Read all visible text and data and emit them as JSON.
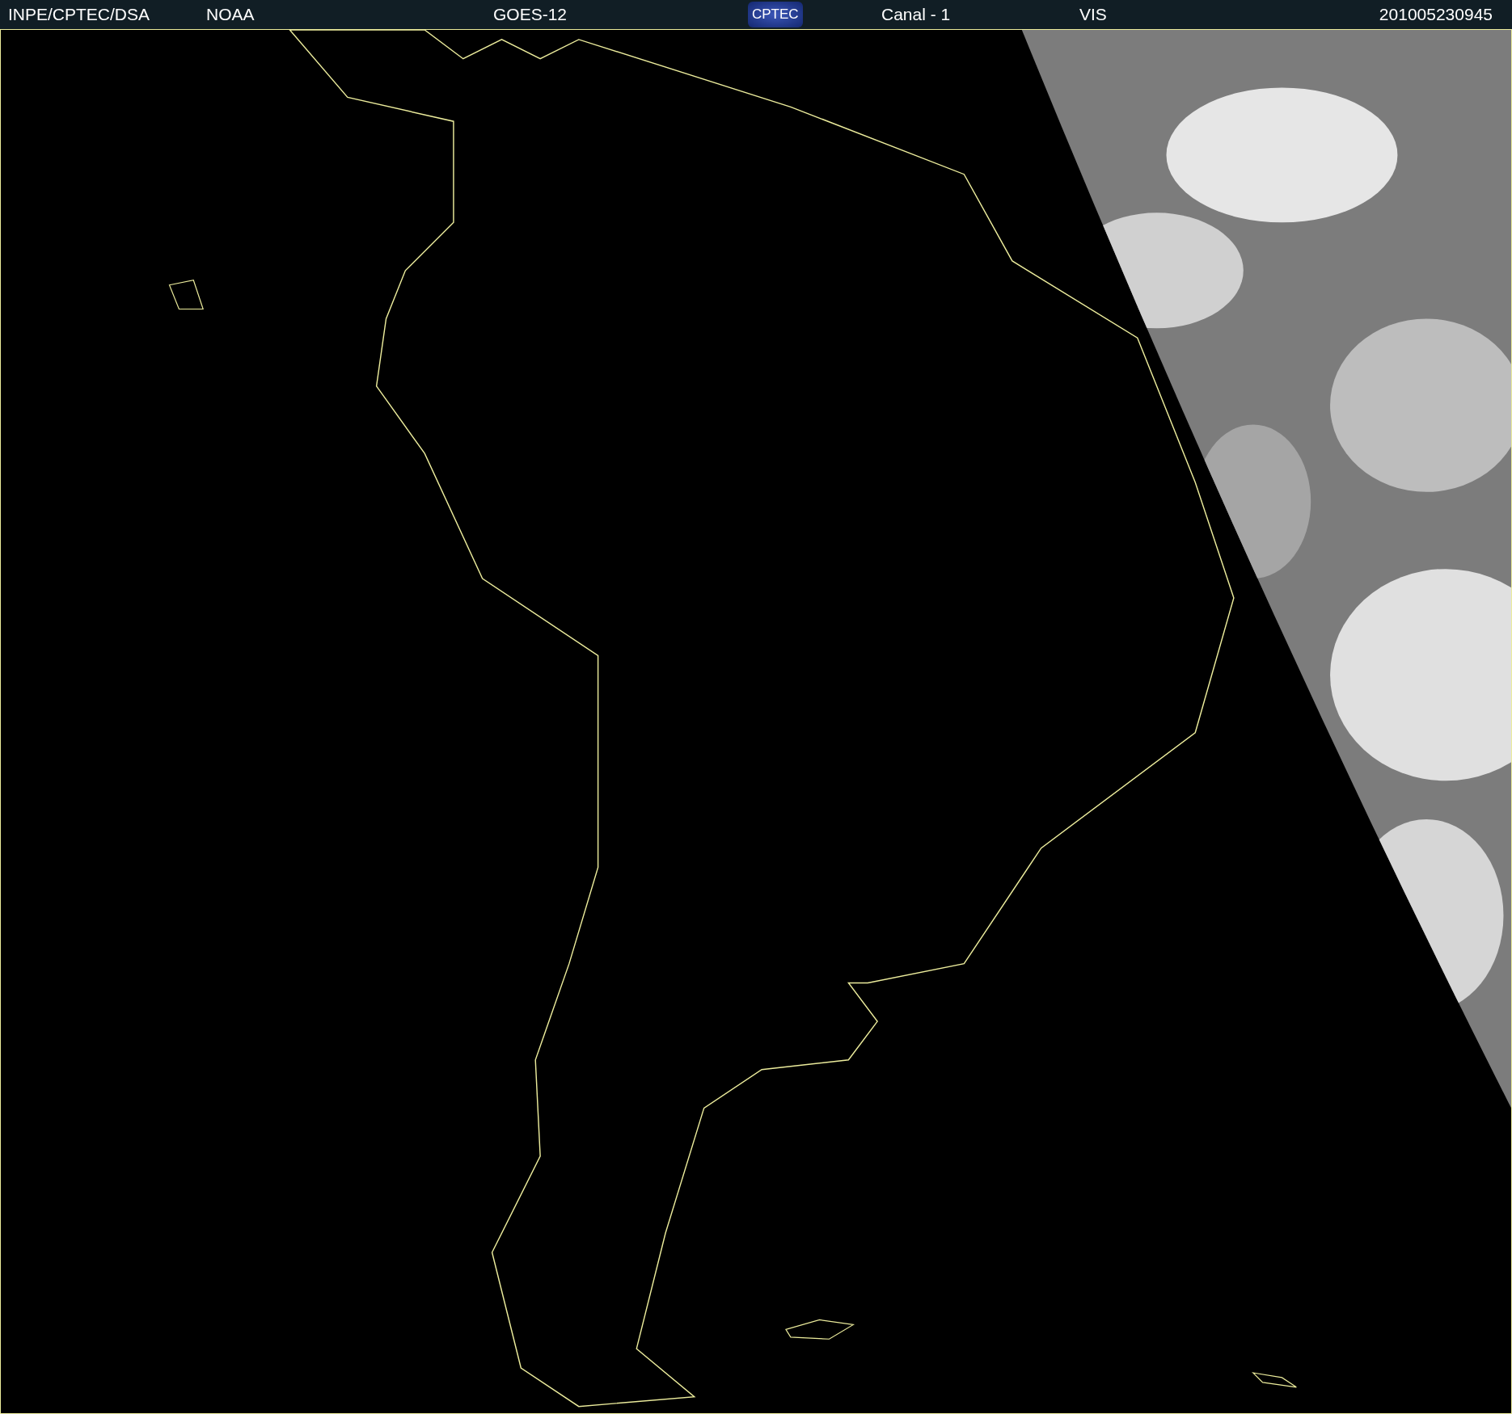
{
  "header": [
    {
      "kind": "text",
      "text": "INPE/CPTEC/DSA"
    },
    {
      "kind": "text",
      "text": "NOAA"
    },
    {
      "kind": "text",
      "text": "GOES-12"
    },
    {
      "kind": "logo",
      "text": "CPTEC"
    },
    {
      "kind": "text",
      "text": "Canal - 1"
    },
    {
      "kind": "text",
      "text": "VIS"
    },
    {
      "kind": "text",
      "text": "201005230945"
    }
  ]
}
